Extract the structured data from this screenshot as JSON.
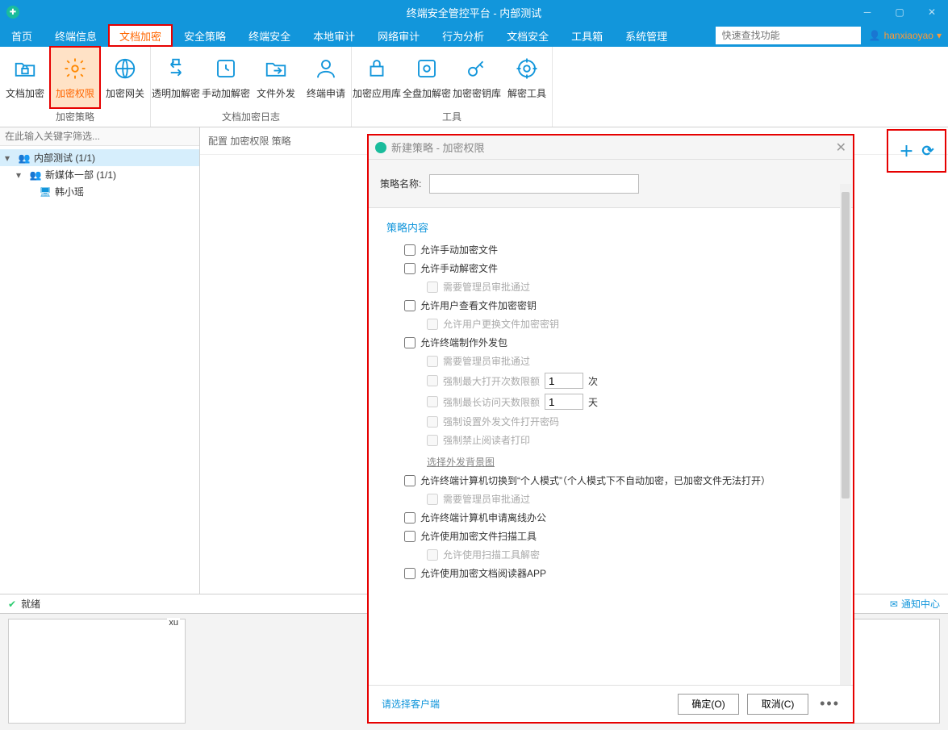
{
  "titlebar": {
    "title": "终端安全管控平台 - 内部测试"
  },
  "menubar": {
    "items": [
      "首页",
      "终端信息",
      "文档加密",
      "安全策略",
      "终端安全",
      "本地审计",
      "网络审计",
      "行为分析",
      "文档安全",
      "工具箱",
      "系统管理"
    ],
    "active_index": 2,
    "search_placeholder": "快速查找功能",
    "user": "hanxiaoyao"
  },
  "ribbon": {
    "groups": [
      {
        "label": "加密策略",
        "buttons": [
          {
            "label": "文档加密",
            "icon": "folder-lock"
          },
          {
            "label": "加密权限",
            "icon": "gear",
            "highlighted": true
          },
          {
            "label": "加密网关",
            "icon": "globe-lock"
          }
        ]
      },
      {
        "label": "文档加密日志",
        "buttons": [
          {
            "label": "透明加解密",
            "icon": "swap"
          },
          {
            "label": "手动加解密",
            "icon": "hand"
          },
          {
            "label": "文件外发",
            "icon": "folder-send"
          },
          {
            "label": "终端申请",
            "icon": "person"
          }
        ]
      },
      {
        "label": "工具",
        "buttons": [
          {
            "label": "加密应用库",
            "icon": "lock-folder"
          },
          {
            "label": "全盘加解密",
            "icon": "disk"
          },
          {
            "label": "加密密钥库",
            "icon": "key"
          },
          {
            "label": "解密工具",
            "icon": "target"
          }
        ]
      }
    ]
  },
  "sidebar": {
    "filter_placeholder": "在此输入关键字筛选...",
    "tree": [
      {
        "label": "内部测试 (1/1)",
        "icon": "users",
        "level": 0,
        "expanded": true,
        "selected": true
      },
      {
        "label": "新媒体一部 (1/1)",
        "icon": "users",
        "level": 1,
        "expanded": true
      },
      {
        "label": "韩小瑶",
        "icon": "monitor",
        "level": 2
      }
    ]
  },
  "breadcrumb": "配置  加密权限  策略",
  "dialog": {
    "title": "新建策略 - 加密权限",
    "name_label": "策略名称:",
    "section_head": "策略内容",
    "items": {
      "manual_encrypt": "允许手动加密文件",
      "manual_decrypt": "允许手动解密文件",
      "manual_decrypt_sub": "需要管理员审批通过",
      "view_key": "允许用户查看文件加密密钥",
      "view_key_sub": "允许用户更换文件加密密钥",
      "make_pkg": "允许终端制作外发包",
      "pkg_sub1": "需要管理员审批通过",
      "pkg_sub2": "强制最大打开次数限额",
      "pkg_sub2_val": "1",
      "pkg_sub2_unit": "次",
      "pkg_sub3": "强制最长访问天数限额",
      "pkg_sub3_val": "1",
      "pkg_sub3_unit": "天",
      "pkg_sub4": "强制设置外发文件打开密码",
      "pkg_sub5": "强制禁止阅读者打印",
      "pkg_link": "选择外发背景图",
      "personal_mode": "允许终端计算机切换到“个人模式”（个人模式下不自动加密，已加密文件无法打开）",
      "personal_mode_sub": "需要管理员审批通过",
      "offline": "允许终端计算机申请离线办公",
      "scan_tool": "允许使用加密文件扫描工具",
      "scan_tool_sub": "允许使用扫描工具解密",
      "reader_app": "允许使用加密文档阅读器APP"
    },
    "footer_link": "请选择客户端",
    "ok": "确定(O)",
    "cancel": "取消(C)"
  },
  "statusbar": {
    "status": "就绪",
    "notif": "通知中心"
  },
  "bottom": {
    "thumb_label": "xu"
  }
}
